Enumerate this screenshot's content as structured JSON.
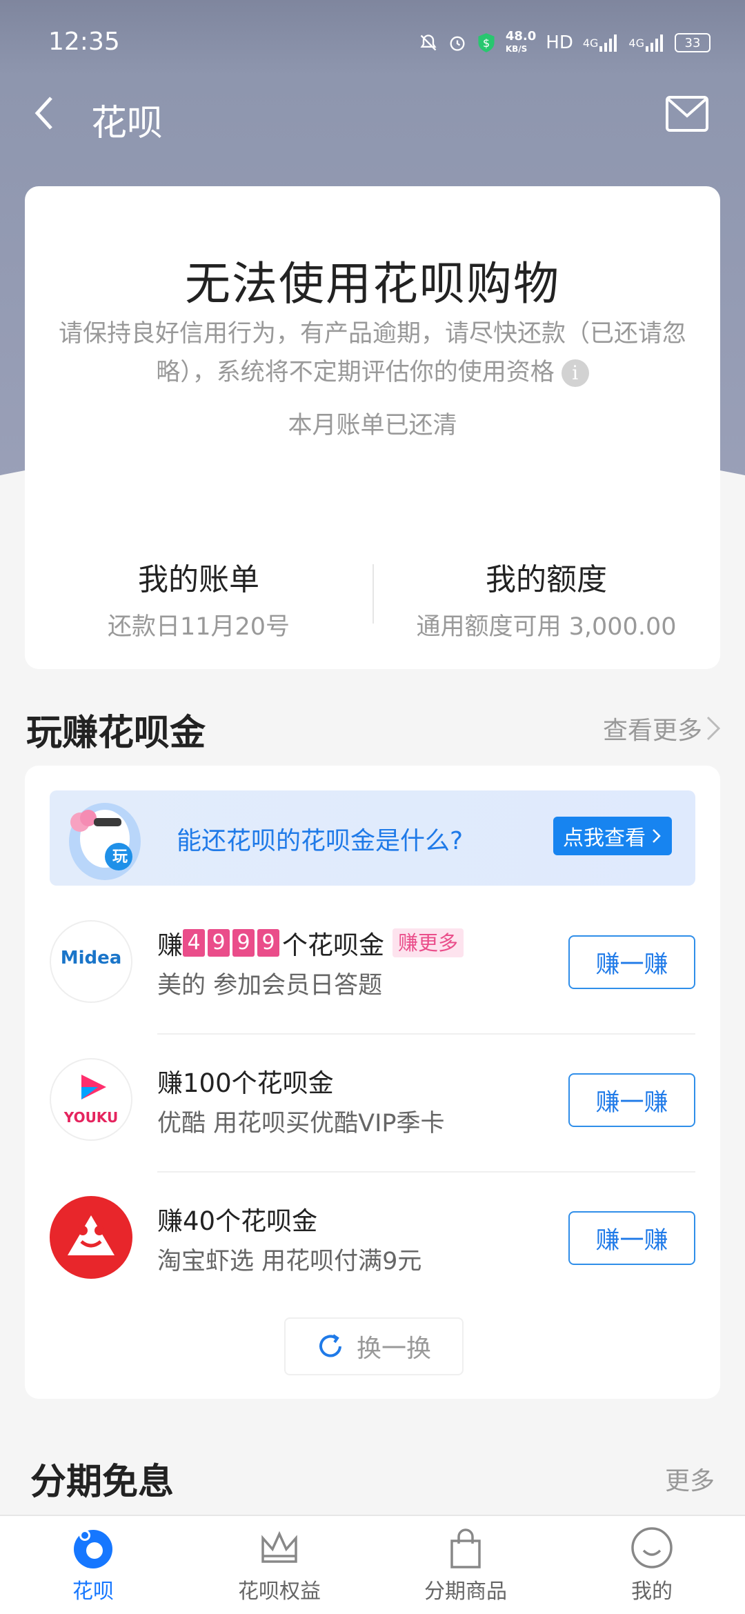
{
  "status_bar": {
    "time": "12:35",
    "net_speed_value": "48.0",
    "net_speed_unit": "KB/S",
    "hd_label": "HD",
    "signal1": "4G",
    "signal2": "4G",
    "battery": "33"
  },
  "header": {
    "title": "花呗"
  },
  "account_card": {
    "status_title": "无法使用花呗购物",
    "status_desc": "请保持良好信用行为，有产品逾期，请尽快还款（已还请忽略），系统将不定期评估你的使用资格",
    "bill_status": "本月账单已还清",
    "my_bill_label": "我的账单",
    "my_bill_sub": "还款日11月20号",
    "my_limit_label": "我的额度",
    "my_limit_sub": "通用额度可用 3,000.00"
  },
  "earn_section": {
    "title": "玩赚花呗金",
    "more": "查看更多",
    "banner_text": "能还花呗的花呗金是什么?",
    "banner_button": "点我查看",
    "banner_badge": "玩",
    "items": [
      {
        "prefix": "赚",
        "digits": [
          "4",
          "9",
          "9",
          "9"
        ],
        "suffix": "个花呗金",
        "tag": "赚更多",
        "desc": "美的 参加会员日答题",
        "logo_text": "Midea",
        "button": "赚一赚"
      },
      {
        "title": "赚100个花呗金",
        "desc": "优酷 用花呗买优酷VIP季卡",
        "logo_text": "YOUKU",
        "button": "赚一赚"
      },
      {
        "title": "赚40个花呗金",
        "desc": "淘宝虾选 用花呗付满9元",
        "button": "赚一赚"
      }
    ],
    "refresh": "换一换"
  },
  "installment_section": {
    "title": "分期免息",
    "more": "更多"
  },
  "bottom_nav": [
    {
      "label": "花呗",
      "icon": "huabei-icon",
      "active": true
    },
    {
      "label": "花呗权益",
      "icon": "crown-icon",
      "active": false
    },
    {
      "label": "分期商品",
      "icon": "shopping-bag-icon",
      "active": false
    },
    {
      "label": "我的",
      "icon": "smiley-icon",
      "active": false
    }
  ],
  "colors": {
    "accent": "#1677ff",
    "header_bg": "#8e96ae",
    "tag_pink": "#ea4d8a"
  }
}
